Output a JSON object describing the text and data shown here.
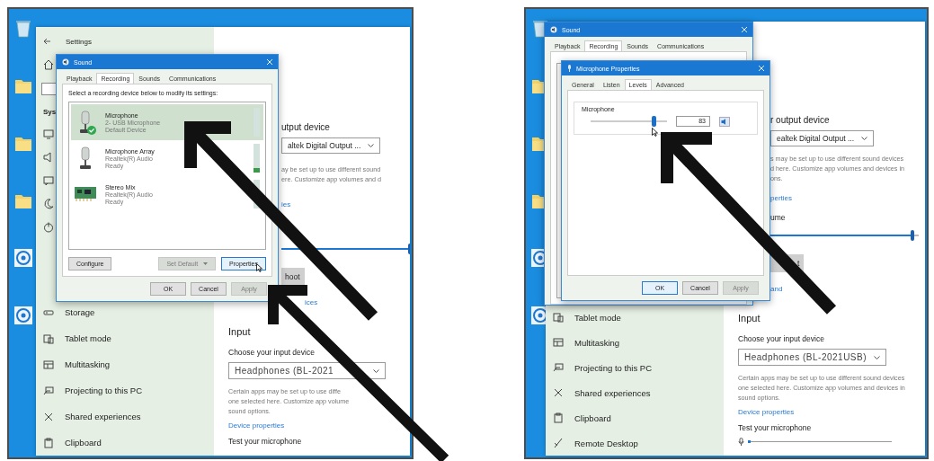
{
  "screenshots": [
    {
      "kind": "sound-devices",
      "settings": {
        "title": "Settings",
        "sidebar_heading": "Sys",
        "sidebar": [
          {
            "label": "Storage",
            "kind": "storage"
          },
          {
            "label": "Tablet mode",
            "kind": "tablet"
          },
          {
            "label": "Multitasking",
            "kind": "multitask"
          },
          {
            "label": "Projecting to this PC",
            "kind": "project"
          },
          {
            "label": "Shared experiences",
            "kind": "share"
          },
          {
            "label": "Clipboard",
            "kind": "clipboard"
          }
        ],
        "output_heading": "utput device",
        "output_device": "altek Digital Output ...",
        "output_note": [
          "ay be set up to use different sound",
          "ere. Customize app volumes and d"
        ],
        "output_link": "ies",
        "volume": {
          "level": 1
        },
        "troubleshoot": "hoot",
        "manage_link": "ices",
        "input_heading": "Input",
        "input_label": "Choose your input device",
        "input_device": "Headphones (BL-2021",
        "input_note": [
          "Certain apps may be set up to use diffe",
          "one selected here. Customize app volume",
          "sound options."
        ],
        "input_link": "Device properties",
        "test_label": "Test your microphone"
      },
      "dialogs": [
        {
          "kind": "sound",
          "title": "Sound",
          "tabs": [
            {
              "label": "Playback",
              "selected": false
            },
            {
              "label": "Recording",
              "selected": true
            },
            {
              "label": "Sounds",
              "selected": false
            },
            {
              "label": "Communications",
              "selected": false
            }
          ],
          "instruction": "Select a recording device below to modify its settings:",
          "devices": [
            {
              "name": "Microphone",
              "detail": "2- USB Microphone",
              "status": "Default Device",
              "kind": "microphone",
              "default": true,
              "selected": true,
              "level": 0
            },
            {
              "name": "Microphone Array",
              "detail": "Realtek(R) Audio",
              "status": "Ready",
              "kind": "microphone",
              "default": false,
              "selected": false,
              "level": 0.15
            },
            {
              "name": "Stereo Mix",
              "detail": "Realtek(R) Audio",
              "status": "Ready",
              "kind": "sound-card",
              "default": false,
              "selected": false,
              "level": 0
            }
          ],
          "actions": [
            {
              "label": "Configure",
              "disabled": false,
              "focused": false,
              "hovered": false,
              "split": false
            },
            {
              "label": "Set Default",
              "disabled": true,
              "focused": false,
              "hovered": false,
              "split": true
            },
            {
              "label": "Properties",
              "disabled": false,
              "focused": true,
              "hovered": true,
              "split": false
            }
          ],
          "buttons": [
            {
              "label": "OK",
              "disabled": false,
              "focused": false
            },
            {
              "label": "Cancel",
              "disabled": false,
              "focused": false
            },
            {
              "label": "Apply",
              "disabled": true,
              "focused": false
            }
          ]
        }
      ]
    },
    {
      "kind": "microphone-levels",
      "settings": {
        "sidebar": [
          {
            "label": "Tablet mode",
            "kind": "tablet"
          },
          {
            "label": "Multitasking",
            "kind": "multitask"
          },
          {
            "label": "Projecting to this PC",
            "kind": "project"
          },
          {
            "label": "Shared experiences",
            "kind": "share"
          },
          {
            "label": "Clipboard",
            "kind": "clipboard"
          },
          {
            "label": "Remote Desktop",
            "kind": "remote"
          }
        ],
        "output_heading": "r output device",
        "output_device": "ealtek Digital Output ...",
        "output_note": [
          "s may be set up to use different sound devices",
          "d here. Customize app volumes and devices in",
          "ons."
        ],
        "output_link": "perties",
        "volume_heading": "ume",
        "volume": {
          "level": 0.97
        },
        "troubleshoot": "t",
        "manage_link": "and",
        "input_heading": "Input",
        "input_label": "Choose your input device",
        "input_device": "Headphones (BL-2021USB)",
        "input_note": [
          "Certain apps may be set up to use different sound devices",
          "one selected here. Customize app volumes and devices in",
          "sound options."
        ],
        "input_link": "Device properties",
        "test_label": "Test your microphone",
        "test_meter": {
          "level": 0.02
        }
      },
      "dialogs": [
        {
          "kind": "sound",
          "title": "Sound",
          "tabs": [
            {
              "label": "Playback",
              "selected": false
            },
            {
              "label": "Recording",
              "selected": true
            },
            {
              "label": "Sounds",
              "selected": false
            },
            {
              "label": "Communications",
              "selected": false
            }
          ]
        },
        {
          "kind": "levels",
          "title": "Microphone Properties",
          "tabs": [
            {
              "label": "General",
              "selected": false
            },
            {
              "label": "Listen",
              "selected": false
            },
            {
              "label": "Levels",
              "selected": true
            },
            {
              "label": "Advanced",
              "selected": false
            }
          ],
          "group": "Microphone",
          "slider": {
            "level": 0.83,
            "hovered": true
          },
          "value": "83",
          "buttons": [
            {
              "label": "OK",
              "disabled": false,
              "focused": true
            },
            {
              "label": "Cancel",
              "disabled": false,
              "focused": false
            },
            {
              "label": "Apply",
              "disabled": true,
              "focused": false
            }
          ]
        }
      ]
    }
  ]
}
